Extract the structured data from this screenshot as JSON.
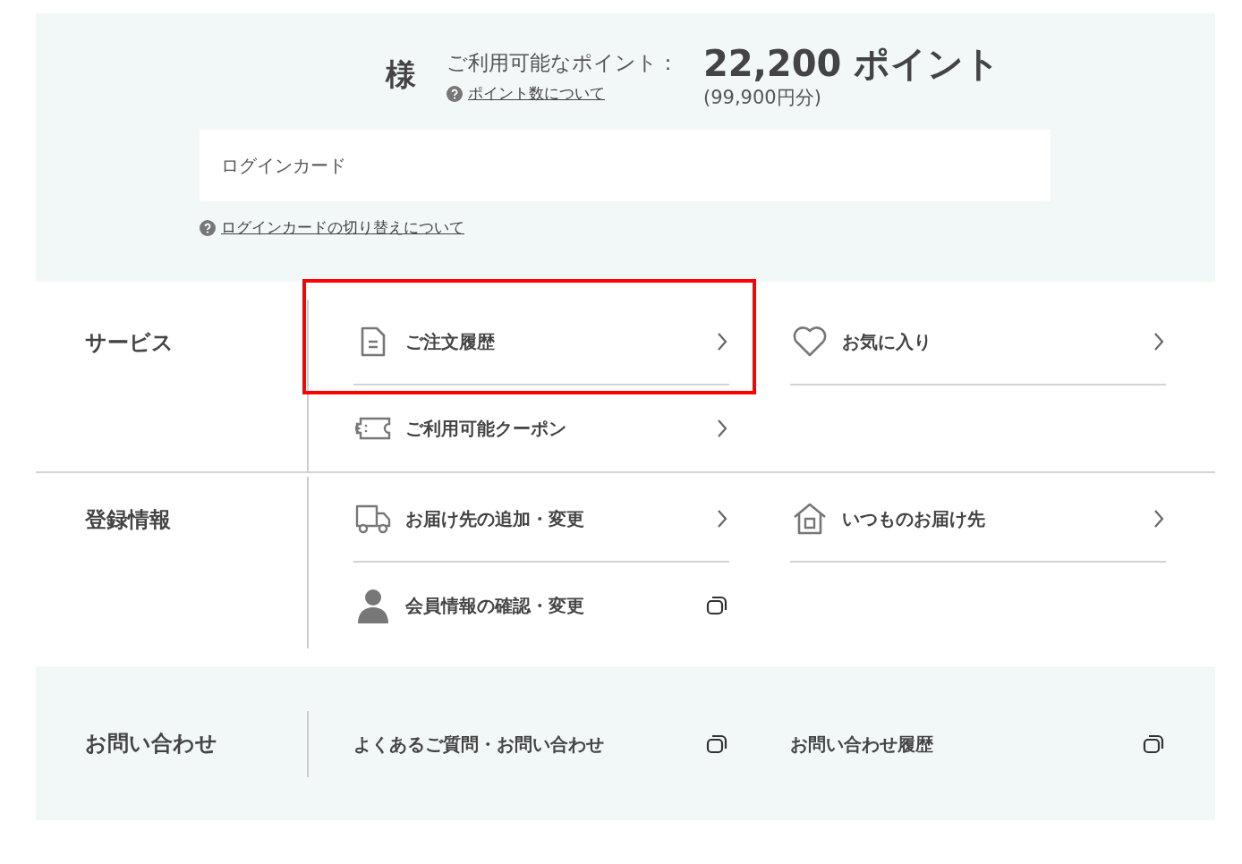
{
  "points": {
    "honorific": "様",
    "label": "ご利用可能なポイント：",
    "value": "22,200 ポイント",
    "yen": "(99,900円分)",
    "help_link": "ポイント数について"
  },
  "login_card": {
    "label": "ログインカード",
    "help_link": "ログインカードの切り替えについて"
  },
  "sections": [
    {
      "title": "サービス",
      "shaded": false,
      "rows": [
        [
          {
            "label": "ご注文履歴",
            "kind": "arrow",
            "highlighted": true
          },
          {
            "label": "お気に入り",
            "kind": "arrow",
            "highlighted": false
          }
        ],
        [
          {
            "label": "ご利用可能クーポン",
            "kind": "arrow",
            "highlighted": false
          }
        ]
      ]
    },
    {
      "title": "登録情報",
      "shaded": false,
      "rows": [
        [
          {
            "label": "お届け先の追加・変更",
            "kind": "arrow",
            "highlighted": false
          },
          {
            "label": "いつものお届け先",
            "kind": "arrow",
            "highlighted": false
          }
        ],
        [
          {
            "label": "会員情報の確認・変更",
            "kind": "external",
            "highlighted": false
          }
        ]
      ]
    },
    {
      "title": "お問い合わせ",
      "shaded": true,
      "rows": [
        [
          {
            "label": "よくあるご質問・お問い合わせ",
            "kind": "external",
            "highlighted": false
          },
          {
            "label": "お問い合わせ履歴",
            "kind": "external",
            "highlighted": false
          }
        ]
      ]
    }
  ]
}
